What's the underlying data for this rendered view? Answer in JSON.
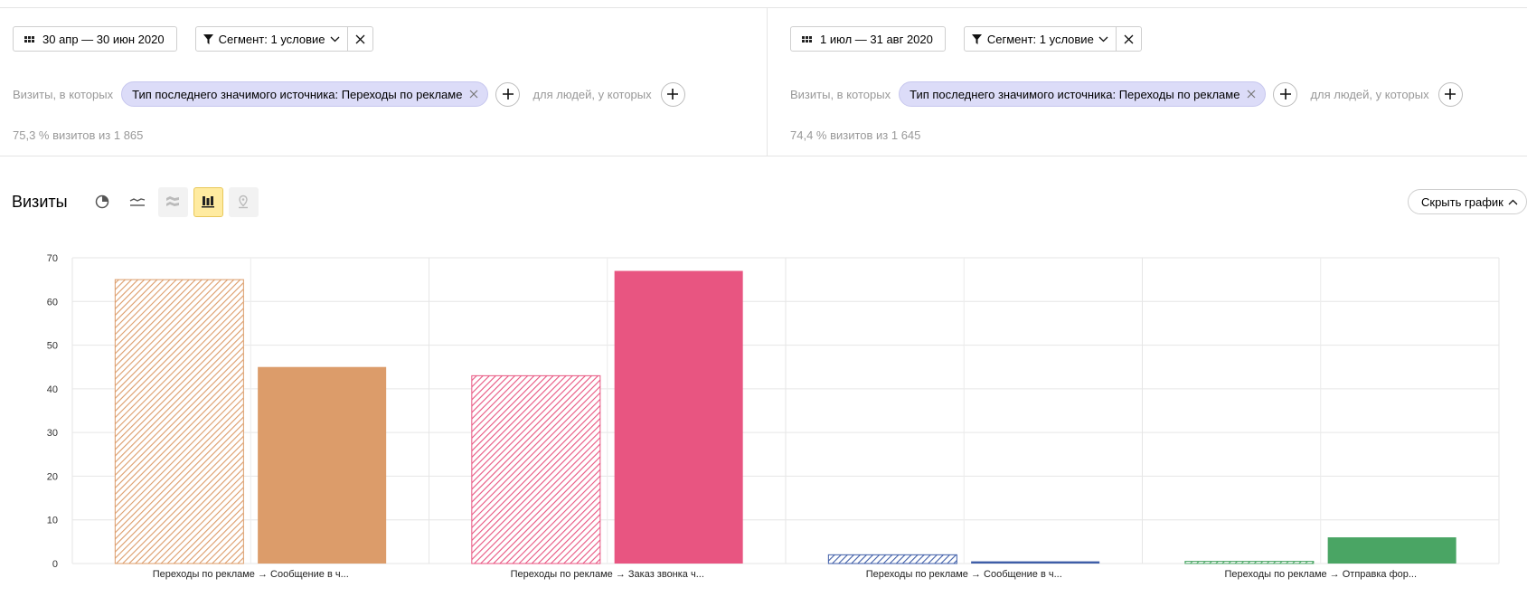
{
  "segments": [
    {
      "date_range": "30 апр — 30 июн 2020",
      "segment_label": "Сегмент: 1 условие",
      "visits_prefix": "Визиты, в которых",
      "condition": "Тип последнего значимого источника: Переходы по рекламе",
      "people_text": "для людей, у которых",
      "share": "75,3 % визитов из 1 865"
    },
    {
      "date_range": "1 июл — 31 авг 2020",
      "segment_label": "Сегмент: 1 условие",
      "visits_prefix": "Визиты, в которых",
      "condition": "Тип последнего значимого источника: Переходы по рекламе",
      "people_text": "для людей, у которых",
      "share": "74,4 % визитов из 1 645"
    }
  ],
  "chart_header": {
    "title": "Визиты",
    "hide_label": "Скрыть график",
    "icons": [
      "pie-chart-icon",
      "line-chart-icon",
      "area-chart-icon",
      "bar-chart-icon",
      "map-icon"
    ]
  },
  "chart_data": {
    "type": "bar",
    "categories": [
      "Переходы по рекламе → Сообщение в ч...",
      "Переходы по рекламе → Заказ звонка ч...",
      "Переходы по рекламе → Сообщение в ч...",
      "Переходы по рекламе → Отправка фор..."
    ],
    "series": [
      {
        "values": [
          65,
          43,
          2,
          0.5
        ]
      },
      {
        "values": [
          45,
          67,
          0.5,
          6
        ]
      }
    ],
    "category_colors": [
      "#dc9c6a",
      "#e85581",
      "#3f5ea8",
      "#4aa564"
    ],
    "ylim": [
      0,
      70
    ],
    "yticks": [
      0,
      10,
      20,
      30,
      40,
      50,
      60,
      70
    ],
    "grid": true,
    "legend": "none"
  }
}
